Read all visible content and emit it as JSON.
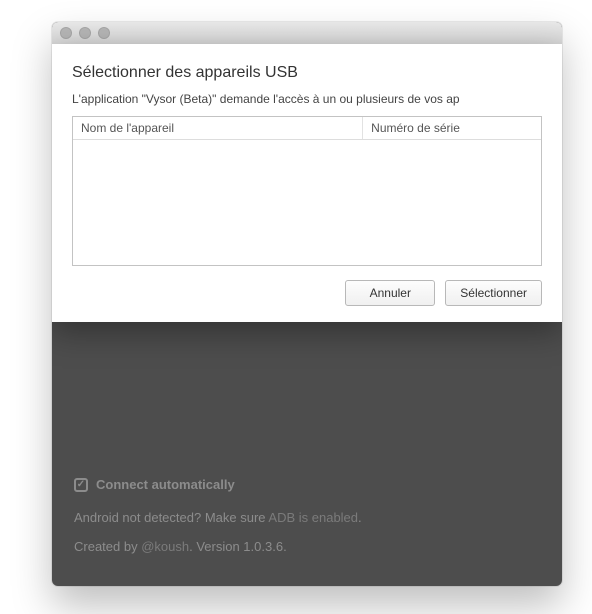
{
  "dialog": {
    "title": "Sélectionner des appareils USB",
    "subtitle": "L'application \"Vysor (Beta)\" demande l'accès à un ou plusieurs de vos ap",
    "columns": {
      "name": "Nom de l'appareil",
      "serial": "Numéro de série"
    },
    "buttons": {
      "cancel": "Annuler",
      "select": "Sélectionner"
    }
  },
  "background": {
    "connect_auto": "Connect automatically",
    "not_detected_prefix": "Android not detected? Make sure ",
    "adb_link": "ADB is enabled",
    "not_detected_suffix": ".",
    "created_prefix": "Created by ",
    "author": "@koush",
    "version_prefix": ". Version ",
    "version": "1.0.3.6",
    "version_suffix": "."
  }
}
